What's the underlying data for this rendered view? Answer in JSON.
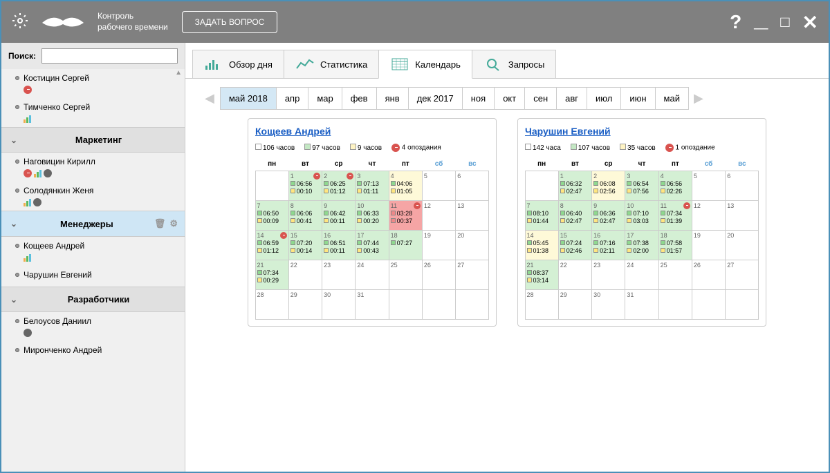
{
  "app": {
    "title_line1": "Контроль",
    "title_line2": "рабочего времени",
    "ask_button": "ЗАДАТЬ ВОПРОС"
  },
  "search": {
    "label": "Поиск:",
    "value": ""
  },
  "sidebar": {
    "top_people": [
      {
        "name": "Костицин Сергей",
        "icons": [
          "clock"
        ]
      },
      {
        "name": "Тимченко Сергей",
        "icons": [
          "bars"
        ]
      }
    ],
    "groups": [
      {
        "name": "Маркетинг",
        "selected": false,
        "people": [
          {
            "name": "Наговицин Кирилл",
            "icons": [
              "clock",
              "bars",
              "cam"
            ]
          },
          {
            "name": "Солодянкин Женя",
            "icons": [
              "bars",
              "cam"
            ]
          }
        ]
      },
      {
        "name": "Менеджеры",
        "selected": true,
        "people": [
          {
            "name": "Кощеев Андрей",
            "icons": [
              "bars"
            ]
          },
          {
            "name": "Чарушин Евгений",
            "icons": []
          }
        ]
      },
      {
        "name": "Разработчики",
        "selected": false,
        "people": [
          {
            "name": "Белоусов Даниил",
            "icons": [
              "cam"
            ]
          },
          {
            "name": "Миронченко Андрей",
            "icons": []
          }
        ]
      }
    ]
  },
  "tabs": [
    {
      "key": "overview",
      "label": "Обзор дня"
    },
    {
      "key": "stats",
      "label": "Статистика"
    },
    {
      "key": "calendar",
      "label": "Календарь",
      "active": true
    },
    {
      "key": "queries",
      "label": "Запросы"
    }
  ],
  "months": [
    "май 2018",
    "апр",
    "мар",
    "фев",
    "янв",
    "дек 2017",
    "ноя",
    "окт",
    "сен",
    "авг",
    "июл",
    "июн",
    "май"
  ],
  "active_month": "май 2018",
  "weekdays": [
    "пн",
    "вт",
    "ср",
    "чт",
    "пт",
    "сб",
    "вс"
  ],
  "calendars": [
    {
      "name": "Кощеев Андрей",
      "stats": {
        "total": "106 часов",
        "active": "97 часов",
        "idle": "9 часов",
        "late": "4 опоздания"
      },
      "cells": [
        {
          "d": "",
          "cls": ""
        },
        {
          "d": 1,
          "cls": "green",
          "t1": "06:56",
          "t2": "00:10",
          "late": true
        },
        {
          "d": 2,
          "cls": "green",
          "t1": "06:25",
          "t2": "01:12",
          "late": true
        },
        {
          "d": 3,
          "cls": "green",
          "t1": "07:13",
          "t2": "01:11"
        },
        {
          "d": 4,
          "cls": "yellow",
          "t1": "04:06",
          "t2": "01:05"
        },
        {
          "d": 5,
          "cls": ""
        },
        {
          "d": 6,
          "cls": ""
        },
        {
          "d": 7,
          "cls": "green",
          "t1": "06:50",
          "t2": "00:09"
        },
        {
          "d": 8,
          "cls": "green",
          "t1": "06:06",
          "t2": "00:41"
        },
        {
          "d": 9,
          "cls": "green",
          "t1": "06:42",
          "t2": "00:11"
        },
        {
          "d": 10,
          "cls": "green",
          "t1": "06:33",
          "t2": "00:20"
        },
        {
          "d": 11,
          "cls": "red",
          "t1": "03:28",
          "t2": "00:37",
          "late": true
        },
        {
          "d": 12,
          "cls": ""
        },
        {
          "d": 13,
          "cls": ""
        },
        {
          "d": 14,
          "cls": "green",
          "t1": "06:59",
          "t2": "01:12",
          "late": true
        },
        {
          "d": 15,
          "cls": "green",
          "t1": "07:20",
          "t2": "00:14"
        },
        {
          "d": 16,
          "cls": "green",
          "t1": "06:51",
          "t2": "00:11"
        },
        {
          "d": 17,
          "cls": "green",
          "t1": "07:44",
          "t2": "00:43"
        },
        {
          "d": 18,
          "cls": "green",
          "t1": "07:27",
          "t2": ""
        },
        {
          "d": 19,
          "cls": ""
        },
        {
          "d": 20,
          "cls": ""
        },
        {
          "d": 21,
          "cls": "green",
          "t1": "07:34",
          "t2": "00:29"
        },
        {
          "d": 22,
          "cls": ""
        },
        {
          "d": 23,
          "cls": ""
        },
        {
          "d": 24,
          "cls": ""
        },
        {
          "d": 25,
          "cls": ""
        },
        {
          "d": 26,
          "cls": ""
        },
        {
          "d": 27,
          "cls": ""
        },
        {
          "d": 28,
          "cls": ""
        },
        {
          "d": 29,
          "cls": ""
        },
        {
          "d": 30,
          "cls": ""
        },
        {
          "d": 31,
          "cls": ""
        },
        {
          "d": "",
          "cls": ""
        },
        {
          "d": "",
          "cls": ""
        },
        {
          "d": "",
          "cls": ""
        }
      ]
    },
    {
      "name": "Чарушин Евгений",
      "stats": {
        "total": "142 часа",
        "active": "107 часов",
        "idle": "35 часов",
        "late": "1 опоздание"
      },
      "cells": [
        {
          "d": "",
          "cls": ""
        },
        {
          "d": 1,
          "cls": "green",
          "t1": "06:32",
          "t2": "02:47"
        },
        {
          "d": 2,
          "cls": "yellow",
          "t1": "06:08",
          "t2": "02:56"
        },
        {
          "d": 3,
          "cls": "green",
          "t1": "06:54",
          "t2": "07:56"
        },
        {
          "d": 4,
          "cls": "green",
          "t1": "06:56",
          "t2": "02:26"
        },
        {
          "d": 5,
          "cls": ""
        },
        {
          "d": 6,
          "cls": ""
        },
        {
          "d": 7,
          "cls": "green",
          "t1": "08:10",
          "t2": "01:44"
        },
        {
          "d": 8,
          "cls": "green",
          "t1": "06:40",
          "t2": "02:47"
        },
        {
          "d": 9,
          "cls": "green",
          "t1": "06:36",
          "t2": "02:47"
        },
        {
          "d": 10,
          "cls": "green",
          "t1": "07:10",
          "t2": "03:03"
        },
        {
          "d": 11,
          "cls": "green",
          "t1": "07:34",
          "t2": "01:39",
          "late": true
        },
        {
          "d": 12,
          "cls": ""
        },
        {
          "d": 13,
          "cls": ""
        },
        {
          "d": 14,
          "cls": "yellow",
          "t1": "05:45",
          "t2": "01:38"
        },
        {
          "d": 15,
          "cls": "green",
          "t1": "07:24",
          "t2": "02:46"
        },
        {
          "d": 16,
          "cls": "green",
          "t1": "07:16",
          "t2": "02:11"
        },
        {
          "d": 17,
          "cls": "green",
          "t1": "07:38",
          "t2": "02:00"
        },
        {
          "d": 18,
          "cls": "green",
          "t1": "07:58",
          "t2": "01:57"
        },
        {
          "d": 19,
          "cls": ""
        },
        {
          "d": 20,
          "cls": ""
        },
        {
          "d": 21,
          "cls": "green",
          "t1": "08:37",
          "t2": "03:14"
        },
        {
          "d": 22,
          "cls": ""
        },
        {
          "d": 23,
          "cls": ""
        },
        {
          "d": 24,
          "cls": ""
        },
        {
          "d": 25,
          "cls": ""
        },
        {
          "d": 26,
          "cls": ""
        },
        {
          "d": 27,
          "cls": ""
        },
        {
          "d": 28,
          "cls": ""
        },
        {
          "d": 29,
          "cls": ""
        },
        {
          "d": 30,
          "cls": ""
        },
        {
          "d": 31,
          "cls": ""
        },
        {
          "d": "",
          "cls": ""
        },
        {
          "d": "",
          "cls": ""
        },
        {
          "d": "",
          "cls": ""
        }
      ]
    }
  ]
}
